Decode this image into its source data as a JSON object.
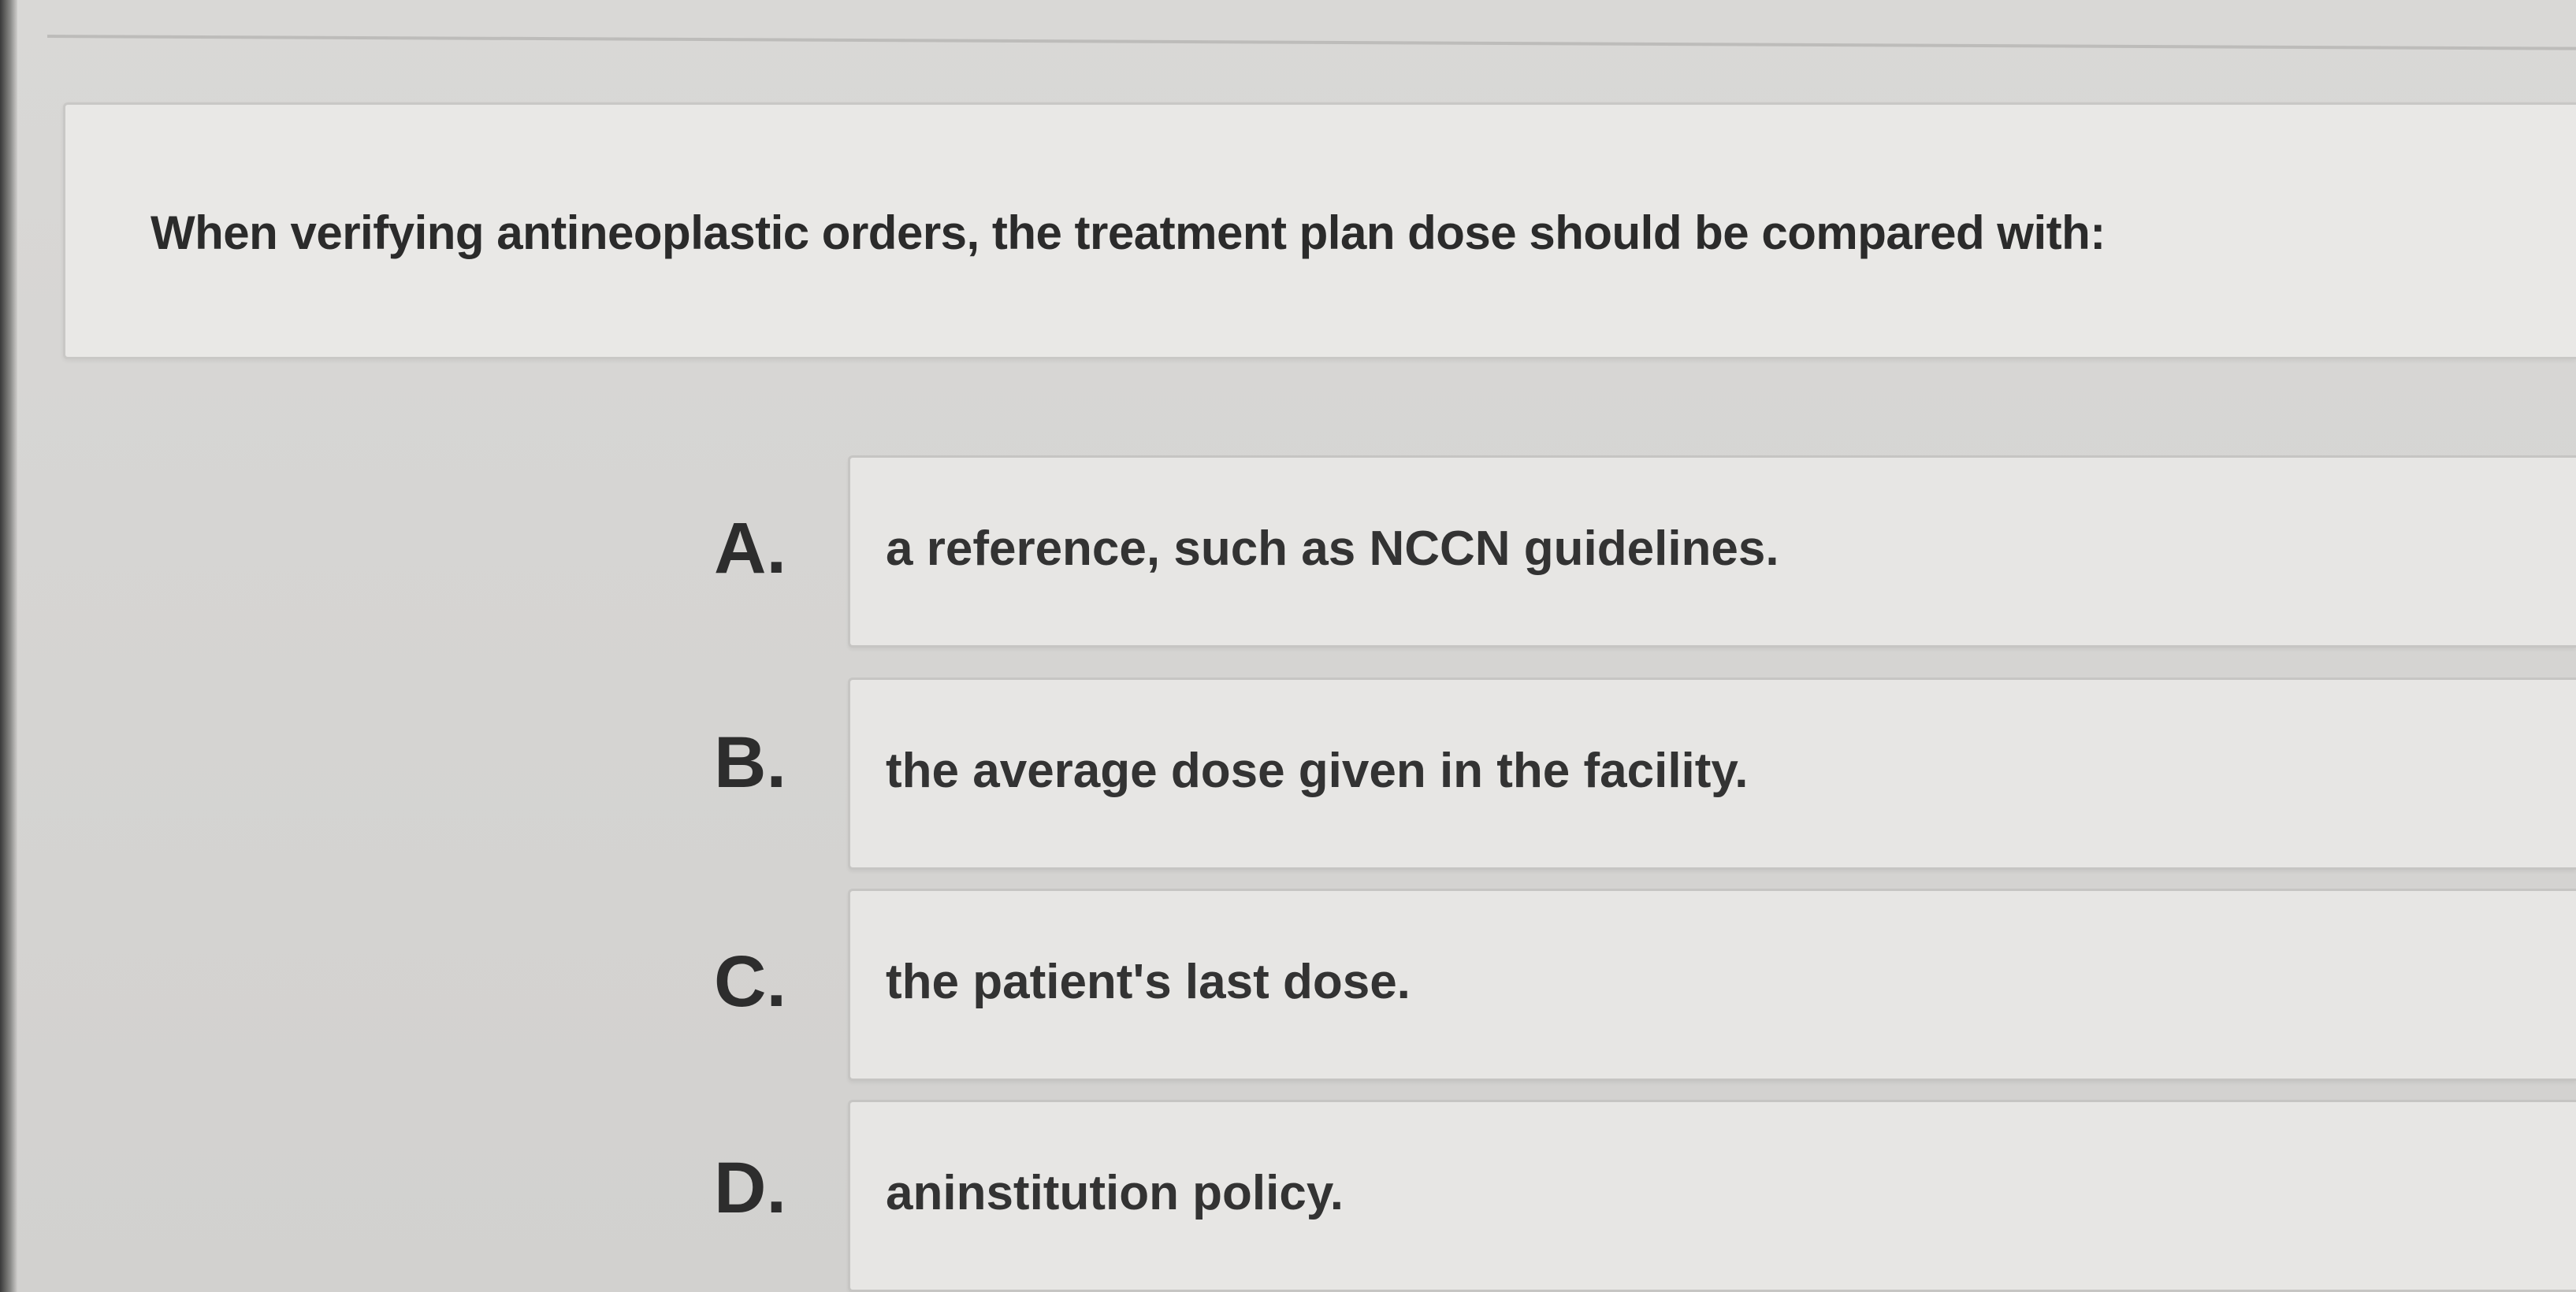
{
  "question": {
    "text": "When verifying antineoplastic orders, the treatment plan dose should be compared with:"
  },
  "options": [
    {
      "letter": "A.",
      "text": "a reference, such as NCCN guidelines."
    },
    {
      "letter": "B.",
      "text": "the average dose given in the facility."
    },
    {
      "letter": "C.",
      "text": "the patient's last dose."
    },
    {
      "letter": "D.",
      "text": "aninstitution policy."
    }
  ]
}
